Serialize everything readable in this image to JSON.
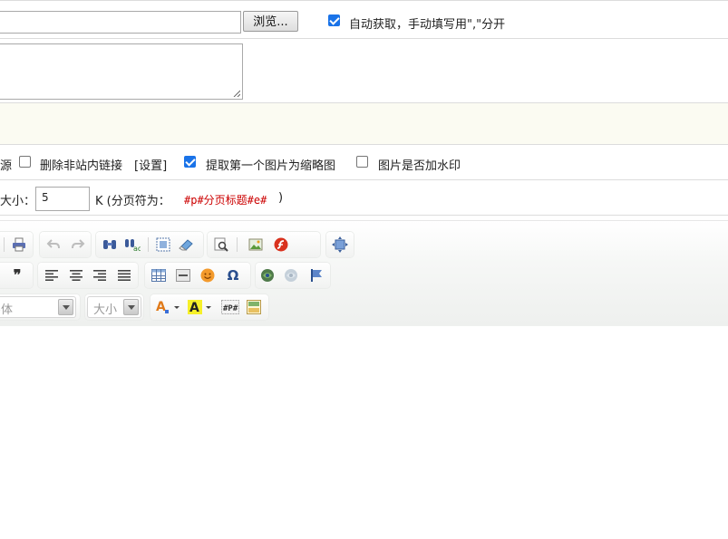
{
  "row1": {
    "browse_label": "浏览...",
    "auto_fetch_label": "自动获取，手动填写用\",\"分开",
    "auto_fetch_checked": true
  },
  "row4": {
    "source_fragment": "源",
    "remove_links_label": "删除非站内链接",
    "settings_link": "[设置]",
    "first_image_thumb_label": "提取第一个图片为缩略图",
    "watermark_label": "图片是否加水印",
    "remove_links_checked": false,
    "first_image_thumb_checked": true,
    "watermark_checked": false
  },
  "row5": {
    "size_label_fragment": "大小：",
    "page_size_value": "5",
    "unit_text": "K (分页符为：",
    "page_break_marker": "#p#分页标题#e#",
    "close_paren": ")"
  },
  "toolbar": {
    "font_combo": "字体",
    "size_combo": "大小",
    "icons": {
      "print": "print-icon",
      "undo": "undo-icon",
      "redo": "redo-icon",
      "find": "find-icon",
      "replace": "replace-icon",
      "select_all": "select-all-icon",
      "eraser": "eraser-icon",
      "preview": "preview-icon",
      "image": "image-icon",
      "flash": "flash-icon",
      "maximize": "maximize-icon",
      "blockquote": "blockquote-icon",
      "align_left": "align-left-icon",
      "align_center": "align-center-icon",
      "align_right": "align-right-icon",
      "justify": "justify-icon",
      "table": "table-icon",
      "horizontal_rule": "horizontal-rule-icon",
      "smiley": "smiley-icon",
      "special_char": "special-char-icon",
      "link": "link-icon",
      "unlink": "unlink-icon",
      "anchor": "anchor-icon",
      "text_color": "text-color-icon",
      "bg_color": "background-color-icon",
      "page_break": "page-break-icon",
      "template": "template-icon"
    }
  }
}
